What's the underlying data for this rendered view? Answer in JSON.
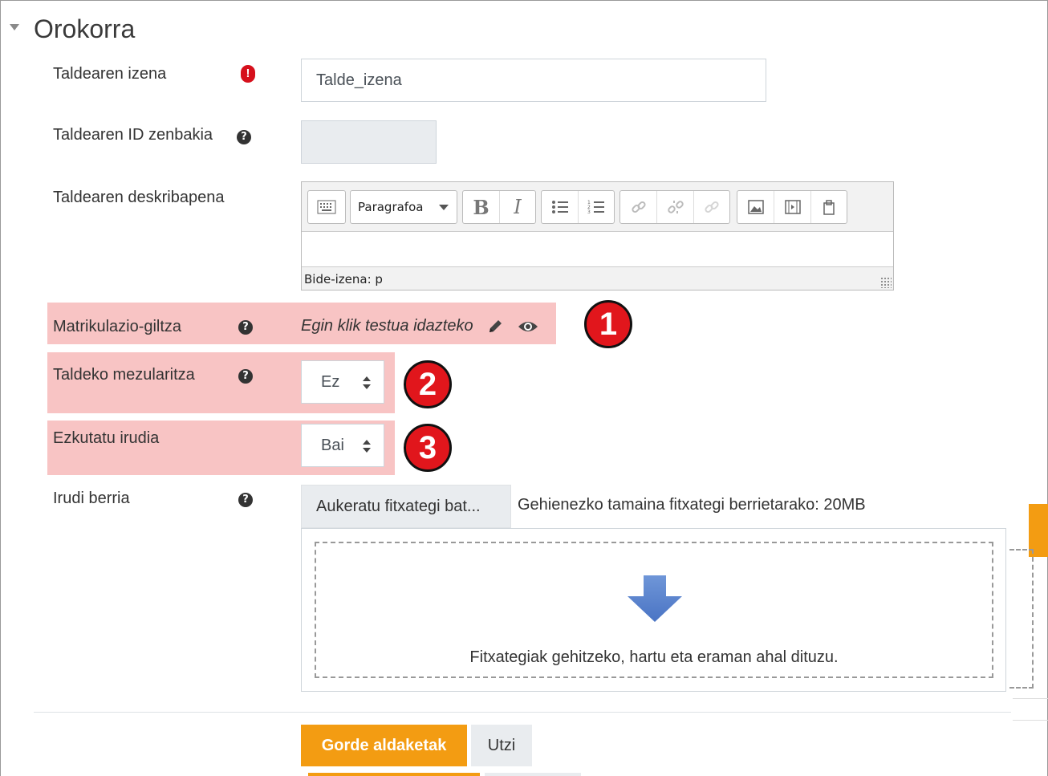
{
  "section": {
    "title": "Orokorra"
  },
  "fields": {
    "name": {
      "label": "Taldearen izena",
      "value": "Talde_izena"
    },
    "id_number": {
      "label": "Taldearen ID zenbakia",
      "value": ""
    },
    "description": {
      "label": "Taldearen deskribapena",
      "paragraph_select": "Paragrafoa",
      "path": "Bide-izena: p"
    },
    "enrolment_key": {
      "label": "Matrikulazio-giltza",
      "placeholder": "Egin klik testua idazteko",
      "badge": "1"
    },
    "group_messaging": {
      "label": "Taldeko mezularitza",
      "value": "Ez",
      "badge": "2"
    },
    "hide_picture": {
      "label": "Ezkutatu irudia",
      "value": "Bai",
      "badge": "3"
    },
    "new_picture": {
      "label": "Irudi berria",
      "choose_button": "Aukeratu fitxategi bat...",
      "max_size_note": "Gehienezko tamaina fitxategi berrietarako: 20MB",
      "drop_text": "Fitxategiak gehitzeko, hartu eta eraman ahal dituzu."
    }
  },
  "buttons": {
    "save": "Gorde aldaketak",
    "cancel": "Utzi"
  },
  "colors": {
    "accent": "#f39c12",
    "highlight": "#f8c4c4",
    "badge": "#e1161c",
    "required": "#d6101c"
  }
}
